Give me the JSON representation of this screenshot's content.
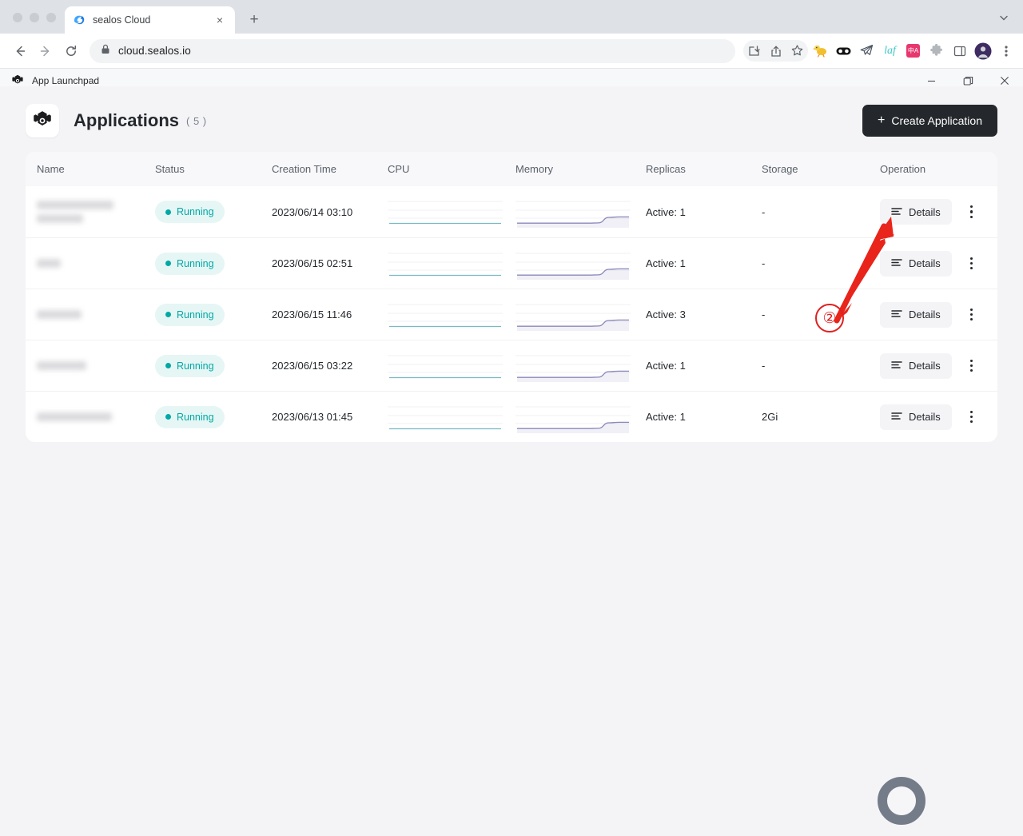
{
  "browser": {
    "tab": {
      "title": "sealos Cloud",
      "favicon": "sealos-favicon",
      "close_label": "×"
    },
    "newtab_label": "+",
    "tabstrip_menu": "chevron-down-icon",
    "omnibox": {
      "url": "cloud.sealos.io",
      "lock": "lock-icon"
    },
    "toolbar_icons": [
      "install-app-icon",
      "share-icon",
      "bookmark-star-icon",
      "duck-extension-icon",
      "glasses-extension-icon",
      "telegram-extension-icon",
      "laf-extension-icon",
      "translate-extension-icon",
      "puzzle-extensions-icon",
      "side-panel-icon",
      "profile-avatar",
      "browser-menu-icon"
    ],
    "laf_label": "laf",
    "translate_label": "中A"
  },
  "app_window": {
    "icon": "app-launchpad-icon",
    "title": "App Launchpad",
    "controls": {
      "minimize": "—",
      "maximize": "❐",
      "close": "✕"
    }
  },
  "header": {
    "logo": "app-launchpad-logo",
    "title": "Applications",
    "count": "( 5 )",
    "create_button": {
      "label": "Create Application",
      "plus": "+"
    }
  },
  "table": {
    "columns": [
      "Name",
      "Status",
      "Creation Time",
      "CPU",
      "Memory",
      "Replicas",
      "Storage",
      "Operation"
    ],
    "details_label": "Details",
    "details_icon": "list-lines-icon",
    "kebab_icon": "more-vertical-icon",
    "rows": [
      {
        "name_redacted": true,
        "name_bars": [
          96,
          58
        ],
        "status": "Running",
        "creation_time": "2023/06/14 03:10",
        "replicas": "Active: 1",
        "storage": "-"
      },
      {
        "name_redacted": true,
        "name_bars": [
          30
        ],
        "status": "Running",
        "creation_time": "2023/06/15 02:51",
        "replicas": "Active: 1",
        "storage": "-"
      },
      {
        "name_redacted": true,
        "name_bars": [
          56
        ],
        "status": "Running",
        "creation_time": "2023/06/15 11:46",
        "replicas": "Active: 3",
        "storage": "-"
      },
      {
        "name_redacted": true,
        "name_bars": [
          62
        ],
        "status": "Running",
        "creation_time": "2023/06/15 03:22",
        "replicas": "Active: 1",
        "storage": "-"
      },
      {
        "name_redacted": true,
        "name_bars": [
          94
        ],
        "status": "Running",
        "creation_time": "2023/06/13 01:45",
        "replicas": "Active: 1",
        "storage": "2Gi"
      }
    ]
  },
  "chart_data": [
    {
      "type": "line",
      "title": "CPU",
      "series": [
        {
          "name": "CPU",
          "values": [
            5,
            5,
            5,
            5,
            5,
            5,
            5,
            5,
            5,
            5,
            5,
            5
          ]
        }
      ],
      "ylim": [
        0,
        100
      ],
      "grid": true,
      "color": "#7ab8c4",
      "legend": "none"
    },
    {
      "type": "area",
      "title": "Memory",
      "series": [
        {
          "name": "Memory",
          "values": [
            6,
            6,
            6,
            6,
            6,
            6,
            6,
            6,
            7,
            30,
            32,
            32
          ]
        }
      ],
      "ylim": [
        0,
        100
      ],
      "grid": true,
      "color": "#8b88bb",
      "legend": "none"
    }
  ],
  "annotations": {
    "step_number": "②",
    "arrow": "red-arrow-to-create-application",
    "color": "#e02020",
    "cursor": "cursor-ring-indicator"
  }
}
